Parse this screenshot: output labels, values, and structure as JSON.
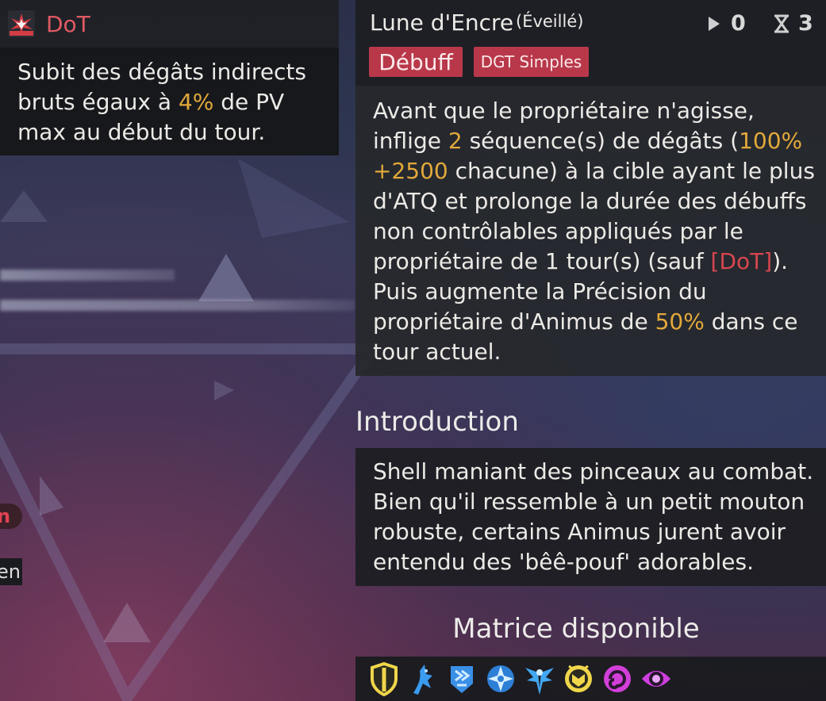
{
  "dot_tooltip": {
    "icon": "red-burst-icon",
    "title": "DoT",
    "desc_part1": "Subit des dégâts indirects bruts égaux à ",
    "desc_percent": "4%",
    "desc_part2": " de PV max au début du tour.",
    "title_color": "#e05a62"
  },
  "side_fragments": {
    "badge": "n",
    "label": "en"
  },
  "skill": {
    "name": "Lune d'Encre",
    "state": "(Éveillé)",
    "cost": "0",
    "cooldown": "3",
    "tag_primary": "Débuff",
    "tag_secondary": "DGT Simples",
    "tag_color": "#b8384a",
    "description": {
      "t1": "Avant que le propriétaire n'agisse, inflige ",
      "hits": "2",
      "t2": " séquence(s) de dégâts (",
      "ratio": "100% +2500",
      "t3": " chacune) à la cible ayant le plus d'ATQ et prolonge la durée des débuffs non contrôlables appliqués par le propriétaire de 1 tour(s) (sauf ",
      "exception": "[DoT]",
      "t4": "). Puis augmente la Précision du propriétaire d'Animus de ",
      "bonus": "50%",
      "t5": " dans ce tour actuel."
    }
  },
  "introduction": {
    "heading": "Introduction",
    "text": "Shell maniant des pinceaux au combat. Bien qu'il ressemble à un petit mouton robuste, certains Animus jurent avoir entendu des 'bêê-pouf' adorables."
  },
  "matrix": {
    "heading": "Matrice disponible",
    "icons": [
      "yellow-shield-icon",
      "blue-claw-icon",
      "blue-badge-icon",
      "blue-compass-icon",
      "blue-wings-icon",
      "yellow-crest-icon",
      "purple-spiral-icon",
      "purple-eye-icon"
    ]
  },
  "colors": {
    "highlight": "#e3a93a",
    "debuff_red": "#d6464f"
  }
}
